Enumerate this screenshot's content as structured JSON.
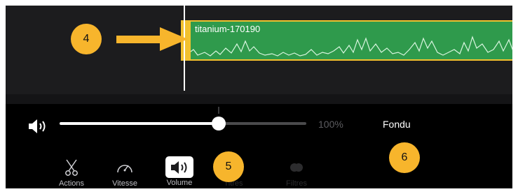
{
  "timeline": {
    "clip": {
      "name": "titanium-170190"
    }
  },
  "annotations": {
    "callout_1": "4",
    "callout_2": "5",
    "callout_3": "6"
  },
  "volume_panel": {
    "level_percent": 100,
    "level_text": "100%",
    "slider_fill_fraction": 0.65,
    "fade_label": "Fondu"
  },
  "toolbar": {
    "tools": [
      {
        "label": "Actions",
        "icon": "scissors-icon"
      },
      {
        "label": "Vitesse",
        "icon": "speedometer-icon"
      },
      {
        "label": "Volume",
        "icon": "speaker-icon"
      },
      {
        "label": "Titres",
        "icon": "text-icon"
      },
      {
        "label": "Filtres",
        "icon": "filter-icon"
      }
    ]
  },
  "colors": {
    "clip_green": "#2f9a4c",
    "selection_yellow": "#f2c12e",
    "callout_yellow": "#f7b52c",
    "background": "#000000"
  }
}
